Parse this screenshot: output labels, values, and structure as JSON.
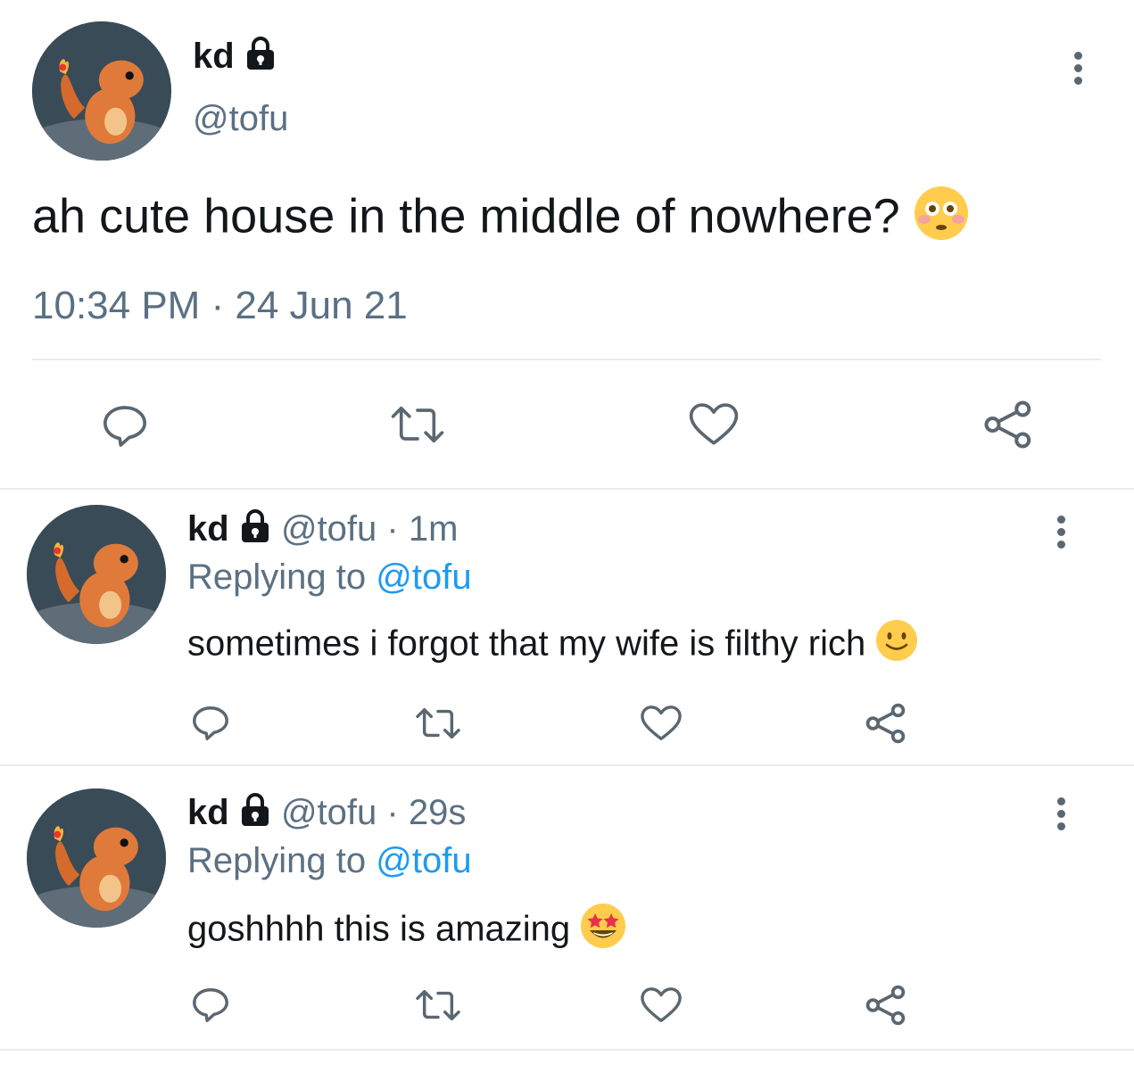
{
  "main_tweet": {
    "display_name": "kd",
    "handle": "@tofu",
    "text": "ah cute house in the middle of nowhere?",
    "emoji": "flushed-face",
    "timestamp": "10:34 PM · 24 Jun 21"
  },
  "replies": [
    {
      "display_name": "kd",
      "handle": "@tofu",
      "separator": "·",
      "time_ago": "1m",
      "replying_prefix": "Replying to",
      "replying_handle": "@tofu",
      "text": "sometimes i forgot that my wife is filthy rich",
      "emoji": "slightly-smiling-face"
    },
    {
      "display_name": "kd",
      "handle": "@tofu",
      "separator": "·",
      "time_ago": "29s",
      "replying_prefix": "Replying to",
      "replying_handle": "@tofu",
      "text": "goshhhh this is amazing",
      "emoji": "star-struck-face"
    }
  ],
  "icons": [
    "lock-icon",
    "more-options-icon",
    "reply-icon",
    "retweet-icon",
    "like-icon",
    "share-icon"
  ],
  "colors": {
    "text": "#14171a",
    "secondary": "#5b7083",
    "link": "#1d9bf0",
    "divider": "#e6ecf0"
  }
}
